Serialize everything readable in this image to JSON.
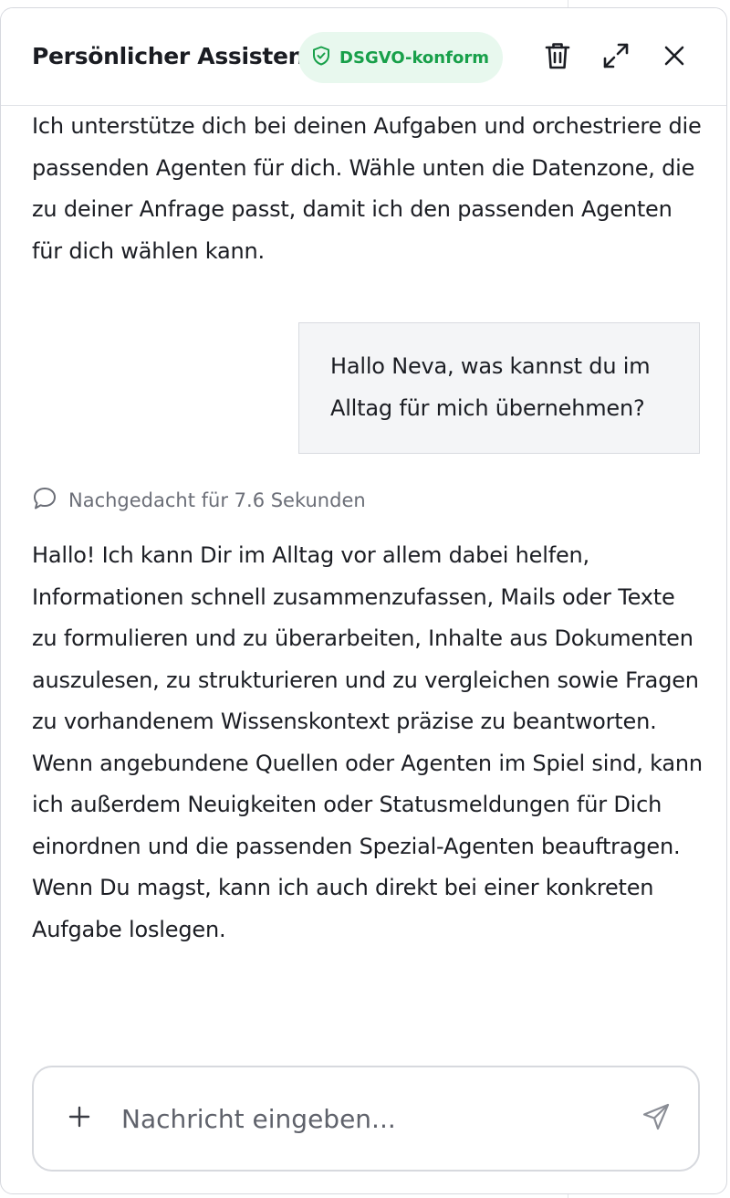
{
  "header": {
    "title": "Persönlicher Assistent",
    "badge_label": "DSGVO-konform",
    "icons": {
      "badge": "shield-check-icon",
      "delete": "trash-icon",
      "expand": "expand-icon",
      "close": "close-icon"
    }
  },
  "conversation": {
    "intro_text": "Ich unterstütze dich bei deinen Aufgaben und orchestriere die passenden Agenten für dich. Wähle unten die Datenzone, die zu deiner Anfrage passt, damit ich den passenden Agenten für dich wählen kann.",
    "user_message": "Hallo Neva, was kannst du im Alltag für mich übernehmen?",
    "thought_label": "Nachgedacht für 7.6 Sekunden",
    "assistant_reply": "Hallo! Ich kann Dir im Alltag vor allem dabei helfen, Informationen schnell zusammenzufassen, Mails oder Texte zu formulieren und zu überarbeiten, Inhalte aus Dokumenten auszulesen, zu strukturieren und zu vergleichen sowie Fragen zu vorhandenem Wissenskontext präzise zu beantworten. Wenn angebundene Quellen oder Agenten im Spiel sind, kann ich außerdem Neuigkeiten oder Statusmeldungen für Dich einordnen und die passenden Spezial-Agenten beauftragen. Wenn Du magst, kann ich auch direkt bei einer konkreten Aufgabe loslegen."
  },
  "composer": {
    "placeholder": "Nachricht eingeben...",
    "value": ""
  },
  "colors": {
    "badge_bg": "#e8f8ee",
    "badge_text": "#18a04a",
    "text": "#1b1d23",
    "muted": "#6b6e77"
  }
}
